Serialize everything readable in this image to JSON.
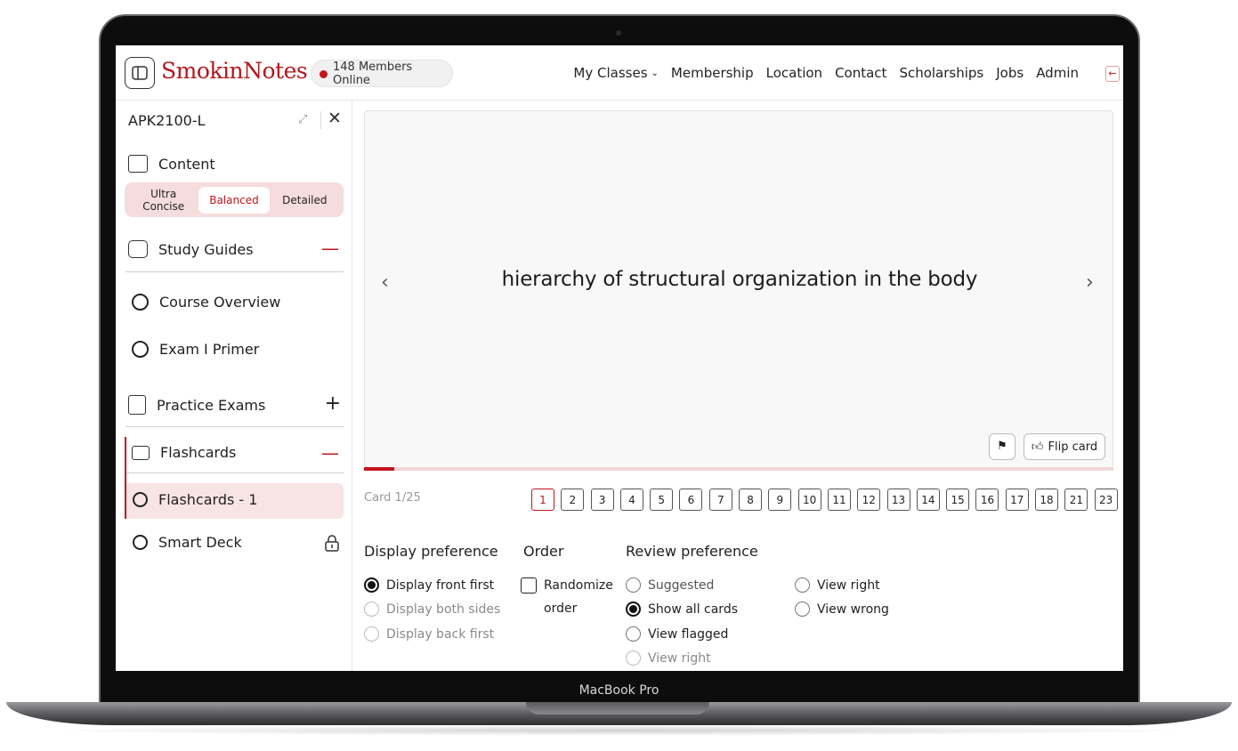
{
  "device": {
    "label": "MacBook Pro"
  },
  "app": {
    "logo_text": "SmokinNotes",
    "online_count_text": "148 Members Online",
    "nav": [
      "My Classes",
      "Membership",
      "Location",
      "Contact",
      "Scholarships",
      "Jobs",
      "Admin"
    ]
  },
  "sidebar": {
    "course": "APK2100-L",
    "content_label": "Content",
    "content_modes": [
      "Ultra Concise",
      "Balanced",
      "Detailed"
    ],
    "content_mode_selected": "Balanced",
    "study_guides_label": "Study Guides",
    "study_guides_items": [
      "Course Overview",
      "Exam I Primer"
    ],
    "practice_exams_label": "Practice Exams",
    "flashcards_label": "Flashcards",
    "flashcards_items": [
      "Flashcards - 1",
      "Smart Deck"
    ]
  },
  "card": {
    "front_text": "hierarchy of structural organization in the body",
    "flip_label": "Flip card",
    "progress_fraction": 0.04
  },
  "pager": {
    "count_text": "Card 1/25",
    "pages": [
      "1",
      "2",
      "3",
      "4",
      "5",
      "6",
      "7",
      "8",
      "9",
      "10",
      "11",
      "12",
      "13",
      "14",
      "15",
      "16",
      "17",
      "18",
      "21",
      "23"
    ],
    "current": "1"
  },
  "prefs": {
    "display_title": "Display preference",
    "display_options": [
      "Display front first",
      "Display both sides",
      "Display back first"
    ],
    "order_title": "Order",
    "order_line1": "Randomize",
    "order_line2": "order",
    "review_title": "Review preference",
    "review_col1": [
      "Suggested",
      "Show all cards",
      "View flagged",
      "View right"
    ],
    "review_col2": [
      "View right",
      "View wrong"
    ]
  },
  "colors": {
    "brand": "#c0161c",
    "accent_bg": "#f6dcdd"
  }
}
